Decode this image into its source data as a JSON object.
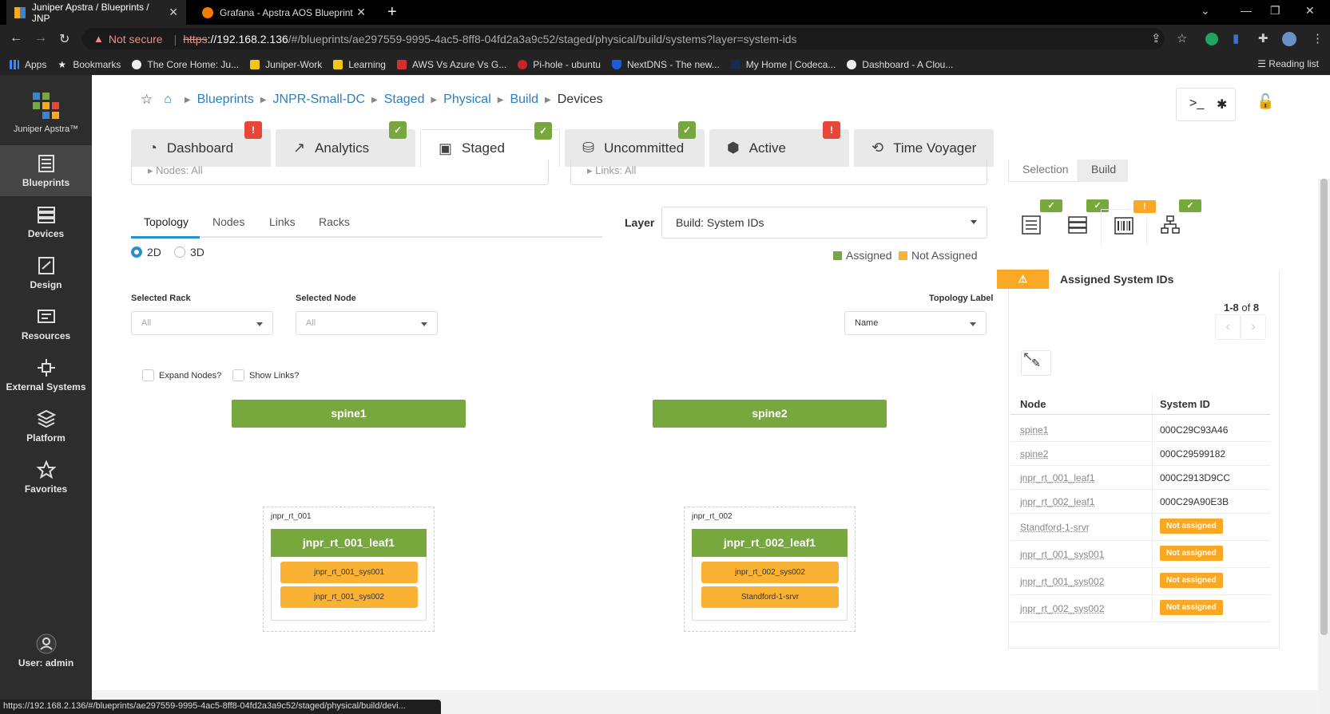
{
  "browser": {
    "tabs": [
      {
        "title": "Juniper Apstra / Blueprints / JNP",
        "active": true
      },
      {
        "title": "Grafana - Apstra AOS Blueprint",
        "active": false
      }
    ],
    "not_secure": "Not secure",
    "url_scheme": "https",
    "url_host": "://192.168.2.136",
    "url_path": "/#/blueprints/ae297559-9995-4ac5-8ff8-04fd2a3a9c52/staged/physical/build/systems?layer=system-ids",
    "bookmarks": [
      "Apps",
      "Bookmarks",
      "The Core Home: Ju...",
      "Juniper-Work",
      "Learning",
      "AWS Vs Azure Vs G...",
      "Pi-hole - ubuntu",
      "NextDNS - The new...",
      "My Home | Codeca...",
      "Dashboard - A Clou..."
    ],
    "reading_list": "Reading list",
    "status_url": "https://192.168.2.136/#/blueprints/ae297559-9995-4ac5-8ff8-04fd2a3a9c52/staged/physical/build/devi..."
  },
  "sidebar": {
    "brand": "Juniper Apstra™",
    "items": [
      {
        "label": "Blueprints",
        "selected": true
      },
      {
        "label": "Devices"
      },
      {
        "label": "Design"
      },
      {
        "label": "Resources"
      },
      {
        "label": "External Systems"
      },
      {
        "label": "Platform"
      },
      {
        "label": "Favorites"
      }
    ],
    "user": "User: admin"
  },
  "breadcrumb": [
    "Blueprints",
    "JNPR-Small-DC",
    "Staged",
    "Physical",
    "Build",
    "Devices"
  ],
  "main_tabs": [
    {
      "label": "Dashboard",
      "badge": "error"
    },
    {
      "label": "Analytics",
      "badge": "ok"
    },
    {
      "label": "Staged",
      "badge": "ok",
      "active": true
    },
    {
      "label": "Uncommitted",
      "badge": "ok"
    },
    {
      "label": "Active",
      "badge": "error"
    },
    {
      "label": "Time Voyager"
    }
  ],
  "filters": {
    "nodes": "Nodes: All",
    "links": "Links: All"
  },
  "subtabs": [
    "Topology",
    "Nodes",
    "Links",
    "Racks"
  ],
  "view_modes": [
    "2D",
    "3D"
  ],
  "layer": {
    "label": "Layer",
    "value": "Build: System IDs"
  },
  "legend": [
    {
      "label": "Assigned",
      "color": "#76a83e"
    },
    {
      "label": "Not Assigned",
      "color": "#f9b234"
    }
  ],
  "selected_rack": {
    "label": "Selected Rack",
    "value": "All"
  },
  "selected_node": {
    "label": "Selected Node",
    "value": "All"
  },
  "topology_label": {
    "label": "Topology Label",
    "value": "Name"
  },
  "checkboxes": {
    "expand_nodes": "Expand Nodes?",
    "show_links": "Show Links?"
  },
  "topology": {
    "spines": [
      "spine1",
      "spine2"
    ],
    "racks": [
      {
        "name": "jnpr_rt_001",
        "leaf": "jnpr_rt_001_leaf1",
        "systems": [
          "jnpr_rt_001_sys001",
          "jnpr_rt_001_sys002"
        ]
      },
      {
        "name": "jnpr_rt_002",
        "leaf": "jnpr_rt_002_leaf1",
        "systems": [
          "jnpr_rt_002_sys002",
          "Standford-1-srvr"
        ]
      }
    ]
  },
  "right_panel": {
    "tabs": [
      "Selection",
      "Build"
    ],
    "title": "Assigned System IDs",
    "pager_range": "1-8",
    "pager_of": "of",
    "pager_total": "8",
    "columns": [
      "Node",
      "System ID"
    ],
    "rows": [
      {
        "node": "spine1",
        "system_id": "000C29C93A46"
      },
      {
        "node": "spine2",
        "system_id": "000C29599182"
      },
      {
        "node": "jnpr_rt_001_leaf1",
        "system_id": "000C2913D9CC"
      },
      {
        "node": "jnpr_rt_002_leaf1",
        "system_id": "000C29A90E3B"
      },
      {
        "node": "Standford-1-srvr",
        "system_id": "Not assigned"
      },
      {
        "node": "jnpr_rt_001_sys001",
        "system_id": "Not assigned"
      },
      {
        "node": "jnpr_rt_001_sys002",
        "system_id": "Not assigned"
      },
      {
        "node": "jnpr_rt_002_sys002",
        "system_id": "Not assigned"
      }
    ]
  },
  "colors": {
    "ok": "#76a83e",
    "error": "#e9463a",
    "warn": "#f9a825",
    "link": "#2a7fc0"
  }
}
